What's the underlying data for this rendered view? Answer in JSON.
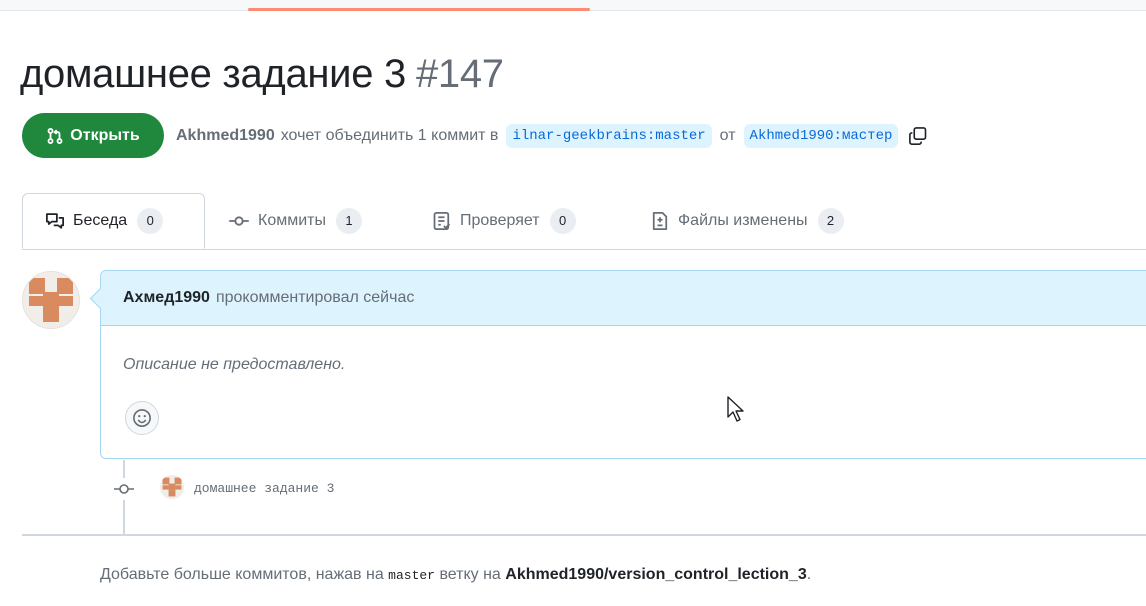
{
  "pr": {
    "title": "домашнее задание 3",
    "number": "#147",
    "status_label": "Открыть",
    "author": "Akhmed1990",
    "action_text": "хочет объединить 1 коммит в",
    "base_branch": "ilnar-geekbrains:master",
    "from_text": "от",
    "head_branch": "Akhmed1990:мастер"
  },
  "tabs": [
    {
      "label": "Беседа",
      "count": "0",
      "icon": "conversation-icon"
    },
    {
      "label": "Коммиты",
      "count": "1",
      "icon": "commit-icon"
    },
    {
      "label": "Проверяет",
      "count": "0",
      "icon": "checks-icon"
    },
    {
      "label": "Файлы изменены",
      "count": "2",
      "icon": "file-diff-icon"
    }
  ],
  "comment": {
    "author": "Ахмед1990",
    "action": "прокомментировал сейчас",
    "body": "Описание не предоставлено."
  },
  "commit": {
    "message": "домашнее задание 3"
  },
  "footer": {
    "prefix": "Добавьте больше коммитов, нажав на",
    "branch": "master",
    "middle": "ветку на",
    "repo": "Akhmed1990/version_control_lection_3",
    "suffix": "."
  },
  "colors": {
    "open_green": "#1f883d",
    "accent_blue": "#0969da",
    "branch_bg": "#ddf4ff",
    "avatar_orange": "#d98a5f"
  }
}
